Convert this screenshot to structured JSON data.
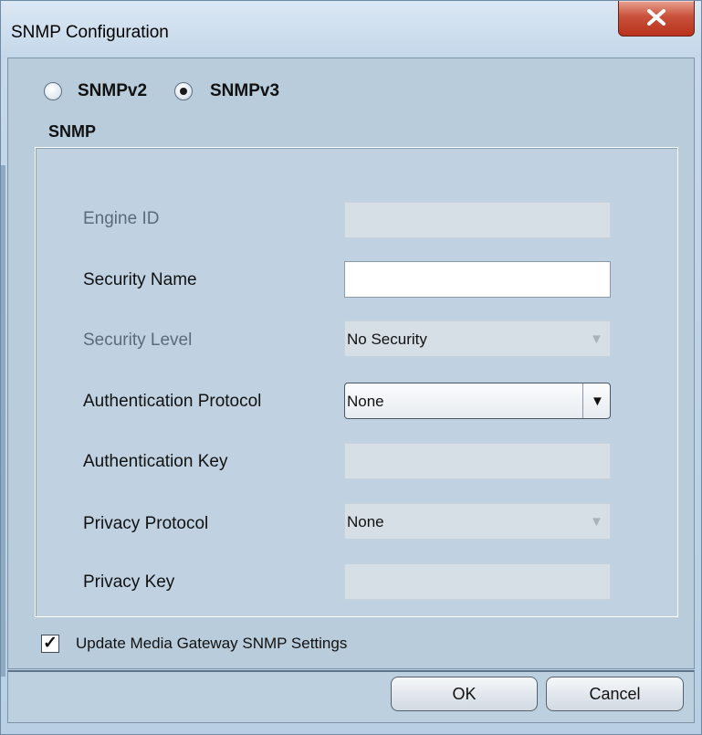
{
  "window": {
    "title": "SNMP Configuration",
    "close_icon": "close-icon"
  },
  "version": {
    "options": [
      {
        "label": "SNMPv2",
        "selected": false
      },
      {
        "label": "SNMPv3",
        "selected": true
      }
    ]
  },
  "section": {
    "title": "SNMP"
  },
  "fields": {
    "engine_id": {
      "label": "Engine ID",
      "value": "",
      "enabled": false
    },
    "security_name": {
      "label": "Security Name",
      "value": "",
      "enabled": true
    },
    "security_level": {
      "label": "Security Level",
      "value": "No Security",
      "enabled": false
    },
    "auth_protocol": {
      "label": "Authentication Protocol",
      "value": "None",
      "enabled": true
    },
    "auth_key": {
      "label": "Authentication Key",
      "value": "",
      "enabled": false
    },
    "privacy_protocol": {
      "label": "Privacy Protocol",
      "value": "None",
      "enabled": false
    },
    "privacy_key": {
      "label": "Privacy Key",
      "value": "",
      "enabled": false
    }
  },
  "update_checkbox": {
    "label": "Update Media Gateway SNMP Settings",
    "checked": true
  },
  "buttons": {
    "ok": "OK",
    "cancel": "Cancel"
  }
}
